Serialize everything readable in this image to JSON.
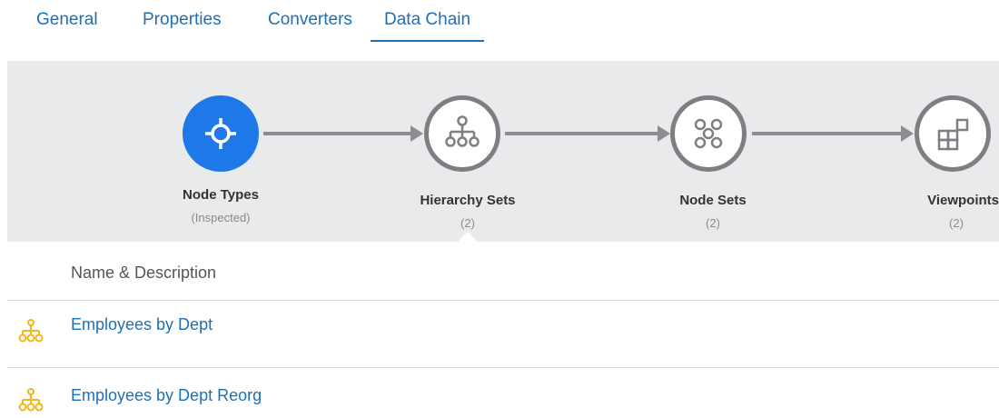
{
  "tabs": [
    {
      "label": "General",
      "active": false
    },
    {
      "label": "Properties",
      "active": false
    },
    {
      "label": "Converters",
      "active": false
    },
    {
      "label": "Data Chain",
      "active": true
    }
  ],
  "chain": {
    "steps": [
      {
        "label": "Node Types",
        "sub": "(Inspected)",
        "icon": "crosshair-icon",
        "active": true
      },
      {
        "label": "Hierarchy Sets",
        "sub": "(2)",
        "icon": "hierarchy-icon",
        "active": false
      },
      {
        "label": "Node Sets",
        "sub": "(2)",
        "icon": "node-set-icon",
        "active": false
      },
      {
        "label": "Viewpoints",
        "sub": "(2)",
        "icon": "viewpoint-icon",
        "active": false
      }
    ]
  },
  "table": {
    "header": "Name & Description",
    "rows": [
      {
        "name": "Employees by Dept",
        "icon": "hierarchy-set-icon"
      },
      {
        "name": "Employees by Dept Reorg",
        "icon": "hierarchy-set-icon"
      }
    ]
  },
  "colors": {
    "accent": "#1f78e8",
    "link": "#1f6fb5",
    "band": "#e9eaec",
    "icon_row": "#f2b61b"
  }
}
